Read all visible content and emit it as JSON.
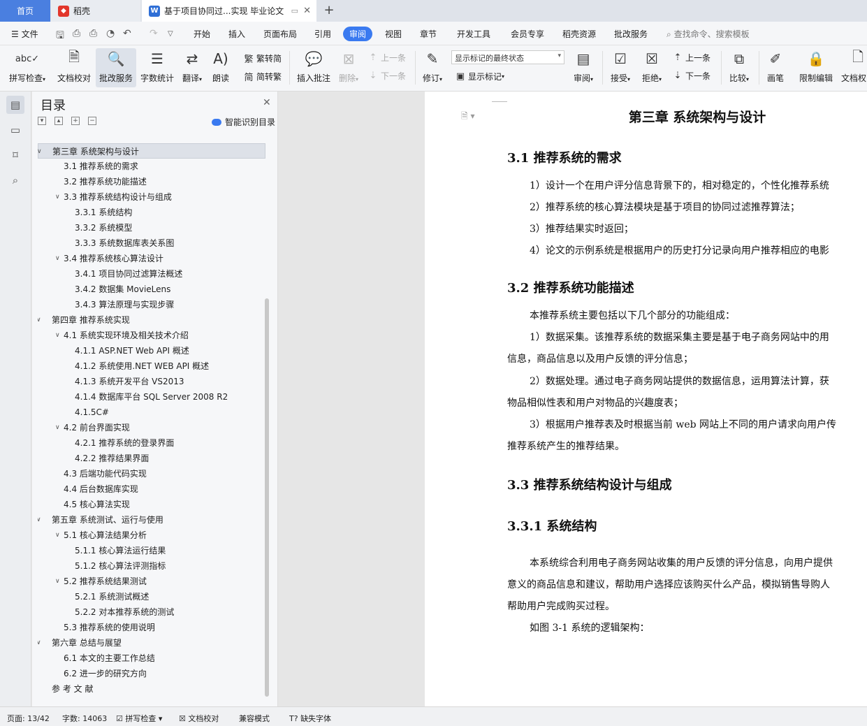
{
  "tabs": {
    "home": "首页",
    "daoke": "稻壳",
    "doc": "基于项目协同过...实现 毕业论文"
  },
  "menu": {
    "file": "文件",
    "items": [
      "开始",
      "插入",
      "页面布局",
      "引用",
      "审阅",
      "视图",
      "章节",
      "开发工具",
      "会员专享",
      "稻壳资源",
      "批改服务"
    ],
    "search": "查找命令、搜索模板"
  },
  "ribbon": {
    "spell": "拼写检查",
    "proof": "文档校对",
    "correct": "批改服务",
    "wordcount": "字数统计",
    "translate": "翻译",
    "read": "朗读",
    "trad": "繁转简",
    "simp": "简转繁",
    "insert_comment": "插入批注",
    "delete": "删除",
    "prev": "上一条",
    "next": "下一条",
    "revise": "修订",
    "markup_state": "显示标记的最终状态",
    "show_markup": "显示标记",
    "review": "审阅",
    "accept": "接受",
    "reject": "拒绝",
    "prev2": "上一条",
    "next2": "下一条",
    "compare": "比较",
    "pen": "画笔",
    "restrict": "限制编辑",
    "docperm": "文档权限"
  },
  "toc": {
    "title": "目录",
    "smart": "智能识别目录",
    "items": [
      {
        "text": "第三章  系统架构与设计",
        "level": 0,
        "arrow": true,
        "selected": true
      },
      {
        "text": "3.1 推荐系统的需求",
        "level": 1
      },
      {
        "text": "3.2 推荐系统功能描述",
        "level": 1
      },
      {
        "text": "3.3  推荐系统结构设计与组成",
        "level": 1,
        "arrow": true
      },
      {
        "text": "3.3.1  系统结构",
        "level": 2
      },
      {
        "text": "3.3.2  系统模型",
        "level": 2
      },
      {
        "text": "3.3.3  系统数据库表关系图",
        "level": 2
      },
      {
        "text": "3.4  推荐系统核心算法设计",
        "level": 1,
        "arrow": true
      },
      {
        "text": "3.4.1  项目协同过滤算法概述",
        "level": 2
      },
      {
        "text": "3.4.2 数据集 MovieLens",
        "level": 2
      },
      {
        "text": "3.4.3 算法原理与实现步骤",
        "level": 2
      },
      {
        "text": "第四章  推荐系统实现",
        "level": 0,
        "arrow": true
      },
      {
        "text": "4.1  系统实现环境及相关技术介绍",
        "level": 1,
        "arrow": true
      },
      {
        "text": "4.1.1 ASP.NET Web API 概述",
        "level": 2
      },
      {
        "text": "4.1.2  系统使用.NET    WEB API 概述",
        "level": 2
      },
      {
        "text": "4.1.3 系统开发平台  VS2013",
        "level": 2
      },
      {
        "text": "4.1.4 数据库平台  SQL Server 2008 R2",
        "level": 2
      },
      {
        "text": "4.1.5C#",
        "level": 2
      },
      {
        "text": "4.2 前台界面实现",
        "level": 1,
        "arrow": true
      },
      {
        "text": "4.2.1  推荐系统的登录界面",
        "level": 2
      },
      {
        "text": "4.2.2  推荐结果界面",
        "level": 2
      },
      {
        "text": "4.3  后端功能代码实现",
        "level": 1
      },
      {
        "text": "4.4 后台数据库实现",
        "level": 1
      },
      {
        "text": "4.5  核心算法实现",
        "level": 1
      },
      {
        "text": "第五章  系统测试、运行与使用",
        "level": 0,
        "arrow": true
      },
      {
        "text": "5.1 核心算法结果分析",
        "level": 1,
        "arrow": true
      },
      {
        "text": "5.1.1 核心算法运行结果",
        "level": 2
      },
      {
        "text": "5.1.2 核心算法评测指标",
        "level": 2
      },
      {
        "text": "5.2  推荐系统结果测试",
        "level": 1,
        "arrow": true
      },
      {
        "text": "5.2.1  系统测试概述",
        "level": 2
      },
      {
        "text": "5.2.2  对本推荐系统的测试",
        "level": 2
      },
      {
        "text": "5.3  推荐系统的使用说明",
        "level": 1
      },
      {
        "text": "第六章  总结与展望",
        "level": 0,
        "arrow": true
      },
      {
        "text": "6.1  本文的主要工作总结",
        "level": 1
      },
      {
        "text": "6.2  进一步的研究方向",
        "level": 1
      },
      {
        "text": "参  考  文  献",
        "level": 0
      }
    ]
  },
  "doc": {
    "chapter": "第三章  系统架构与设计",
    "s31": "3.1 推荐系统的需求",
    "r1": "1）设计一个在用户评分信息背景下的，相对稳定的，个性化推荐系统",
    "r2": "2）推荐系统的核心算法模块是基于项目的协同过滤推荐算法；",
    "r3": "3）推荐结果实时返回；",
    "r4": "4）论文的示例系统是根据用户的历史打分记录向用户推荐相应的电影",
    "s32": "3.2 推荐系统功能描述",
    "f0": "本推荐系统主要包括以下几个部分的功能组成：",
    "f1": "1）数据采集。该推荐系统的数据采集主要是基于电子商务网站中的用",
    "f1b": "信息，商品信息以及用户反馈的评分信息；",
    "f2": "2）数据处理。通过电子商务网站提供的数据信息，运用算法计算，获",
    "f2b": "物品相似性表和用户对物品的兴趣度表；",
    "f3": "3）根据用户推荐表及时根据当前 web 网站上不同的用户请求向用户传",
    "f3b": "推荐系统产生的推荐结果。",
    "s33": "3.3  推荐系统结构设计与组成",
    "s331": "3.3.1  系统结构",
    "g1": "本系统综合利用电子商务网站收集的用户反馈的评分信息，向用户提供",
    "g1b": "意义的商品信息和建议，帮助用户选择应该购买什么产品，模拟销售导购人",
    "g1c": "帮助用户完成购买过程。",
    "g2": "如图 3-1  系统的逻辑架构："
  },
  "status": {
    "page": "页面: 13/42",
    "words": "字数: 14063",
    "spell": "拼写检查",
    "proof": "文档校对",
    "compat": "兼容模式",
    "missing_font": "缺失字体"
  }
}
